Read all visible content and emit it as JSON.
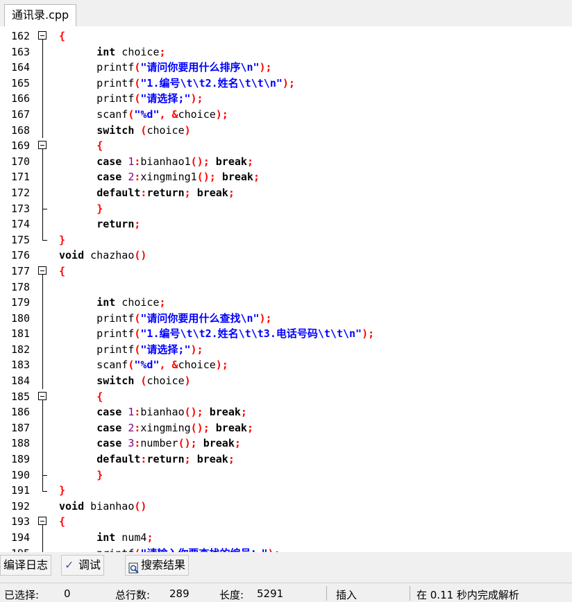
{
  "tab": {
    "title": "通讯录.cpp"
  },
  "lines": [
    {
      "num": "162",
      "fold": "box",
      "html": "<span class='p'>{</span>"
    },
    {
      "num": "163",
      "fold": "line",
      "html": "    <span class='k'>int</span> choice<span class='p'>;</span>"
    },
    {
      "num": "164",
      "fold": "line",
      "html": "    printf<span class='p'>(</span><span class='s'>\"请问你要用什么排序\\n\"</span><span class='p'>);</span>"
    },
    {
      "num": "165",
      "fold": "line",
      "html": "    printf<span class='p'>(</span><span class='s'>\"1.编号\\t\\t2.姓名\\t\\t\\n\"</span><span class='p'>);</span>"
    },
    {
      "num": "166",
      "fold": "line",
      "html": "    printf<span class='p'>(</span><span class='s'>\"请选择;\"</span><span class='p'>);</span>"
    },
    {
      "num": "167",
      "fold": "line",
      "html": "    scanf<span class='p'>(</span><span class='s'>\"%d\"</span><span class='p'>, &amp;</span>choice<span class='p'>);</span>"
    },
    {
      "num": "168",
      "fold": "line",
      "html": "    <span class='k'>switch</span> <span class='p'>(</span>choice<span class='p'>)</span>"
    },
    {
      "num": "169",
      "fold": "box",
      "html": "    <span class='p'>{</span>"
    },
    {
      "num": "170",
      "fold": "line",
      "html": "    <span class='k'>case</span> <span class='n'>1</span><span class='p'>:</span>bianhao1<span class='p'>();</span> <span class='k'>break</span><span class='p'>;</span>"
    },
    {
      "num": "171",
      "fold": "line",
      "html": "    <span class='k'>case</span> <span class='n'>2</span><span class='p'>:</span>xingming1<span class='p'>();</span> <span class='k'>break</span><span class='p'>;</span>"
    },
    {
      "num": "172",
      "fold": "line",
      "html": "    <span class='k'>default</span><span class='p'>:</span><span class='k'>return</span><span class='p'>;</span> <span class='k'>break</span><span class='p'>;</span>"
    },
    {
      "num": "173",
      "fold": "tee",
      "html": "    <span class='p'>}</span>"
    },
    {
      "num": "174",
      "fold": "line",
      "html": "    <span class='k'>return</span><span class='p'>;</span>"
    },
    {
      "num": "175",
      "fold": "end",
      "html": "<span class='p'>}</span>"
    },
    {
      "num": "176",
      "fold": "none",
      "html": "<span class='k'>void</span> chazhao<span class='p'>()</span>"
    },
    {
      "num": "177",
      "fold": "box",
      "html": "<span class='p'>{</span>"
    },
    {
      "num": "178",
      "fold": "line",
      "html": ""
    },
    {
      "num": "179",
      "fold": "line",
      "html": "    <span class='k'>int</span> choice<span class='p'>;</span>"
    },
    {
      "num": "180",
      "fold": "line",
      "html": "    printf<span class='p'>(</span><span class='s'>\"请问你要用什么查找\\n\"</span><span class='p'>);</span>"
    },
    {
      "num": "181",
      "fold": "line",
      "html": "    printf<span class='p'>(</span><span class='s'>\"1.编号\\t\\t2.姓名\\t\\t3.电话号码\\t\\t\\n\"</span><span class='p'>);</span>"
    },
    {
      "num": "182",
      "fold": "line",
      "html": "    printf<span class='p'>(</span><span class='s'>\"请选择;\"</span><span class='p'>);</span>"
    },
    {
      "num": "183",
      "fold": "line",
      "html": "    scanf<span class='p'>(</span><span class='s'>\"%d\"</span><span class='p'>, &amp;</span>choice<span class='p'>);</span>"
    },
    {
      "num": "184",
      "fold": "line",
      "html": "    <span class='k'>switch</span> <span class='p'>(</span>choice<span class='p'>)</span>"
    },
    {
      "num": "185",
      "fold": "box",
      "html": "    <span class='p'>{</span>"
    },
    {
      "num": "186",
      "fold": "line",
      "html": "    <span class='k'>case</span> <span class='n'>1</span><span class='p'>:</span>bianhao<span class='p'>();</span> <span class='k'>break</span><span class='p'>;</span>"
    },
    {
      "num": "187",
      "fold": "line",
      "html": "    <span class='k'>case</span> <span class='n'>2</span><span class='p'>:</span>xingming<span class='p'>();</span> <span class='k'>break</span><span class='p'>;</span>"
    },
    {
      "num": "188",
      "fold": "line",
      "html": "    <span class='k'>case</span> <span class='n'>3</span><span class='p'>:</span>number<span class='p'>();</span> <span class='k'>break</span><span class='p'>;</span>"
    },
    {
      "num": "189",
      "fold": "line",
      "html": "    <span class='k'>default</span><span class='p'>:</span><span class='k'>return</span><span class='p'>;</span> <span class='k'>break</span><span class='p'>;</span>"
    },
    {
      "num": "190",
      "fold": "tee",
      "html": "    <span class='p'>}</span>"
    },
    {
      "num": "191",
      "fold": "end",
      "html": "<span class='p'>}</span>"
    },
    {
      "num": "192",
      "fold": "none",
      "html": "<span class='k'>void</span> bianhao<span class='p'>()</span>"
    },
    {
      "num": "193",
      "fold": "box",
      "html": "<span class='p'>{</span>"
    },
    {
      "num": "194",
      "fold": "line",
      "html": "    <span class='k'>int</span> num4<span class='p'>;</span>"
    },
    {
      "num": "195",
      "fold": "line",
      "html": "    printf<span class='p'>(</span><span class='s'>\"请输入你要查找的编号：\"</span><span class='p'>);</span>"
    }
  ],
  "bottom_tabs": {
    "compile_log": "编译日志",
    "debug": "调试",
    "search_results": "搜索结果"
  },
  "status": {
    "selected_label": "已选择:",
    "selected_value": "0",
    "total_lines_label": "总行数:",
    "total_lines_value": "289",
    "length_label": "长度:",
    "length_value": "5291",
    "insert_mode": "插入",
    "parse_message": "在 0.11 秒内完成解析"
  }
}
